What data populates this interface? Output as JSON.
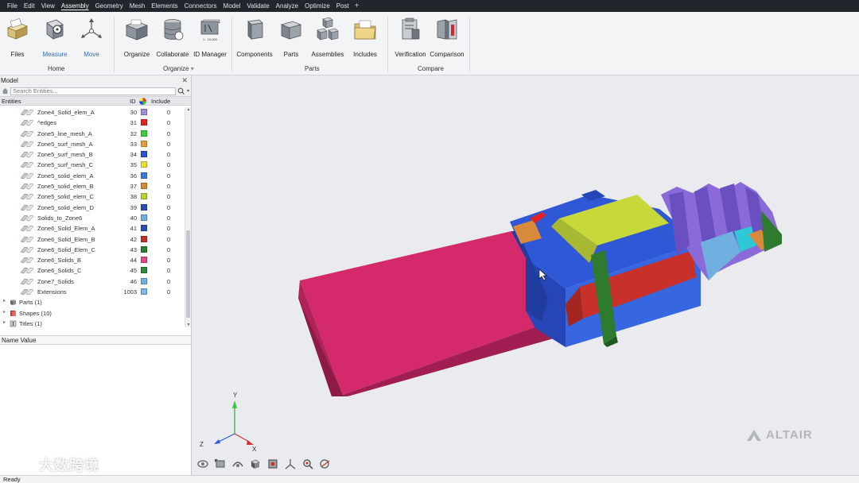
{
  "menu": [
    "File",
    "Edit",
    "View",
    "Assembly",
    "Geometry",
    "Mesh",
    "Elements",
    "Connectors",
    "Model",
    "Validate",
    "Analyze",
    "Optimize",
    "Post"
  ],
  "menu_active": "Assembly",
  "ribbon": {
    "files": "Files",
    "measure": "Measure",
    "move": "Move",
    "organize": "Organize",
    "collaborate": "Collaborate",
    "id_manager": "ID Manager",
    "id_manager_range": "1 - 10,000",
    "components": "Components",
    "parts": "Parts",
    "assemblies": "Assemblies",
    "includes": "Includes",
    "verification": "Verification",
    "comparison": "Comparison",
    "groups": {
      "home": "Home",
      "organize": "Organize",
      "parts": "Parts",
      "compare": "Compare"
    }
  },
  "panel": {
    "title": "Model",
    "search_placeholder": "Search Entities...",
    "columns": {
      "entities": "Entities",
      "id": "ID",
      "include": "Include"
    },
    "rows": [
      {
        "name": "Zone4_Solid_elem_A",
        "id": "30",
        "color": "#a58ad6",
        "include": "0"
      },
      {
        "name": "^edges",
        "id": "31",
        "color": "#e02424",
        "include": "0"
      },
      {
        "name": "Zone5_line_mesh_A",
        "id": "32",
        "color": "#3ccf3c",
        "include": "0"
      },
      {
        "name": "Zone5_surf_mesh_A",
        "id": "33",
        "color": "#e0a040",
        "include": "0"
      },
      {
        "name": "Zone5_surf_mesh_B",
        "id": "34",
        "color": "#2a56c9",
        "include": "0"
      },
      {
        "name": "Zone5_surf_mesh_C",
        "id": "35",
        "color": "#e8e03a",
        "include": "0"
      },
      {
        "name": "Zone5_solid_elem_A",
        "id": "36",
        "color": "#3a7ad8",
        "include": "0"
      },
      {
        "name": "Zone5_solid_elem_B",
        "id": "37",
        "color": "#d68a3a",
        "include": "0"
      },
      {
        "name": "Zone5_solid_elem_C",
        "id": "38",
        "color": "#b8d43a",
        "include": "0"
      },
      {
        "name": "Zone5_solid_elem_D",
        "id": "39",
        "color": "#2a4fb0",
        "include": "0"
      },
      {
        "name": "Solids_to_Zone6",
        "id": "40",
        "color": "#6fb0e0",
        "include": "0"
      },
      {
        "name": "Zone6_Solid_Elem_A",
        "id": "41",
        "color": "#2a4fb0",
        "include": "0"
      },
      {
        "name": "Zone6_Solid_Elem_B",
        "id": "42",
        "color": "#c0302a",
        "include": "0"
      },
      {
        "name": "Zone6_Solid_Elem_C",
        "id": "43",
        "color": "#2e7a2e",
        "include": "0"
      },
      {
        "name": "Zone6_Solids_B",
        "id": "44",
        "color": "#e04a8a",
        "include": "0"
      },
      {
        "name": "Zone6_Solids_C",
        "id": "45",
        "color": "#2e8a3e",
        "include": "0"
      },
      {
        "name": "Zone7_Solids",
        "id": "46",
        "color": "#6fb0e0",
        "include": "0"
      },
      {
        "name": "Extensions",
        "id": "1003",
        "color": "#7ab8e8",
        "include": "0"
      }
    ],
    "groups": [
      {
        "label": "Parts (1)"
      },
      {
        "label": "Shapes (10)"
      },
      {
        "label": "Titles (1)"
      }
    ],
    "name_value_header": "Name Value"
  },
  "viewport": {
    "axis_x": "X",
    "axis_y": "Y",
    "axis_z": "Z",
    "brand": "ALTAIR"
  },
  "watermark": "大数跨境",
  "status": "Ready",
  "colors": {
    "menubar_bg": "#20262c",
    "accent_blue": "#2f6fb9",
    "part_pink": "#d42a6c",
    "part_blue": "#2f58d6",
    "part_yellow": "#c8d83a",
    "part_purple": "#8a6ad8"
  }
}
